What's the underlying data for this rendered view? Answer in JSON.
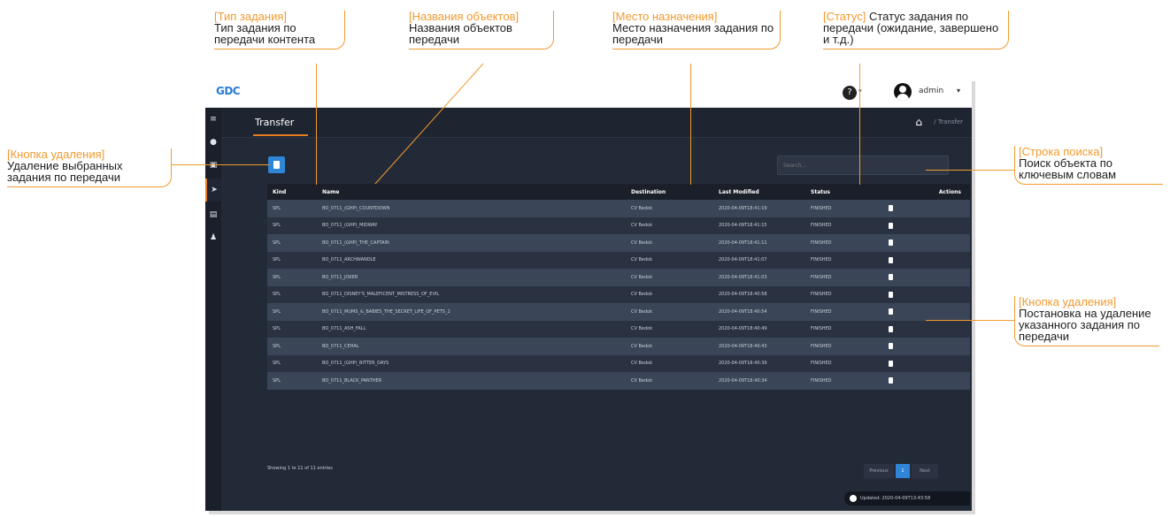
{
  "app": {
    "logo": "GDC",
    "user": "admin",
    "page_title": "Transfer",
    "breadcrumb": "/ Transfer"
  },
  "sidebar": {
    "items": [
      {
        "icon": "menu-icon",
        "glyph": "≡"
      },
      {
        "icon": "clock-icon",
        "glyph": "●"
      },
      {
        "icon": "film-icon",
        "glyph": "▣"
      },
      {
        "icon": "send-icon",
        "glyph": "➤"
      },
      {
        "icon": "library-icon",
        "glyph": "▤"
      },
      {
        "icon": "user-icon",
        "glyph": "♟"
      }
    ]
  },
  "search": {
    "placeholder": "Search..."
  },
  "table": {
    "columns": [
      "Kind",
      "Name",
      "Destination",
      "Last Modified",
      "Status",
      "Actions"
    ],
    "rows": [
      {
        "kind": "SPL",
        "name": "BO_0711_(GHP)_COUNTDOWN",
        "destination": "CV Bedok",
        "modified": "2020-04-09T18:41:19",
        "status": "FINISHED"
      },
      {
        "kind": "SPL",
        "name": "BO_0711_(GHP)_MIDWAY",
        "destination": "CV Bedok",
        "modified": "2020-04-09T18:41:15",
        "status": "FINISHED"
      },
      {
        "kind": "SPL",
        "name": "BO_0711_(GHP)_THE_CAPTAIN",
        "destination": "CV Bedok",
        "modified": "2020-04-09T18:41:11",
        "status": "FINISHED"
      },
      {
        "kind": "SPL",
        "name": "BO_0711_ARCHWANDLE",
        "destination": "CV Bedok",
        "modified": "2020-04-09T18:41:07",
        "status": "FINISHED"
      },
      {
        "kind": "SPL",
        "name": "BO_0711_JOKER",
        "destination": "CV Bedok",
        "modified": "2020-04-09T18:41:03",
        "status": "FINISHED"
      },
      {
        "kind": "SPL",
        "name": "BO_0711_DISNEY'S_MALEFICENT_MISTRESS_OF_EVIL",
        "destination": "CV Bedok",
        "modified": "2020-04-09T18:40:58",
        "status": "FINISHED"
      },
      {
        "kind": "SPL",
        "name": "BO_0711_MUMS_&_BABIES_THE_SECRET_LIFE_OF_PETS_2",
        "destination": "CV Bedok",
        "modified": "2020-04-09T18:40:54",
        "status": "FINISHED"
      },
      {
        "kind": "SPL",
        "name": "BO_0711_ASH_FALL",
        "destination": "CV Bedok",
        "modified": "2020-04-09T18:40:49",
        "status": "FINISHED"
      },
      {
        "kind": "SPL",
        "name": "BO_0711_CEHAL",
        "destination": "CV Bedok",
        "modified": "2020-04-09T18:40:43",
        "status": "FINISHED"
      },
      {
        "kind": "SPL",
        "name": "BO_0711_(GHP)_BITTER_DAYS",
        "destination": "CV Bedok",
        "modified": "2020-04-09T18:40:39",
        "status": "FINISHED"
      },
      {
        "kind": "SPL",
        "name": "BO_0711_BLACK_PANTHER",
        "destination": "CV Bedok",
        "modified": "2020-04-09T18:40:34",
        "status": "FINISHED"
      }
    ]
  },
  "footer": {
    "showing": "Showing 1 to 11 of 11 entries",
    "prev": "Previous",
    "page": "1",
    "next": "Next",
    "updated": "Updated: 2020-04-09T13:43:58"
  },
  "callouts": {
    "kind": {
      "tag": "[Тип задания]",
      "text": "Тип задания по передачи контента"
    },
    "names": {
      "tag": "[Названия объектов]",
      "text": "Названия объектов передачи"
    },
    "destination": {
      "tag": "[Место назначения]",
      "text": "Место назначения задания по передачи"
    },
    "status": {
      "tag": "[Статус]",
      "text": "Статус задания по передачи (ожидание, завершено и т.д.)"
    },
    "delete_selected": {
      "tag": "[Кнопка удаления]",
      "text": "Удаление выбранных задания по передачи"
    },
    "search": {
      "tag": "[Строка поиска]",
      "text": "Поиск объекта по ключевым словам"
    },
    "delete_row": {
      "tag": "[Кнопка удаления]",
      "text": "Постановка на удаление указанного задания по передачи"
    }
  },
  "colors": {
    "accent": "#f39a2e",
    "primary": "#2f86d8",
    "panel": "#232a37"
  }
}
